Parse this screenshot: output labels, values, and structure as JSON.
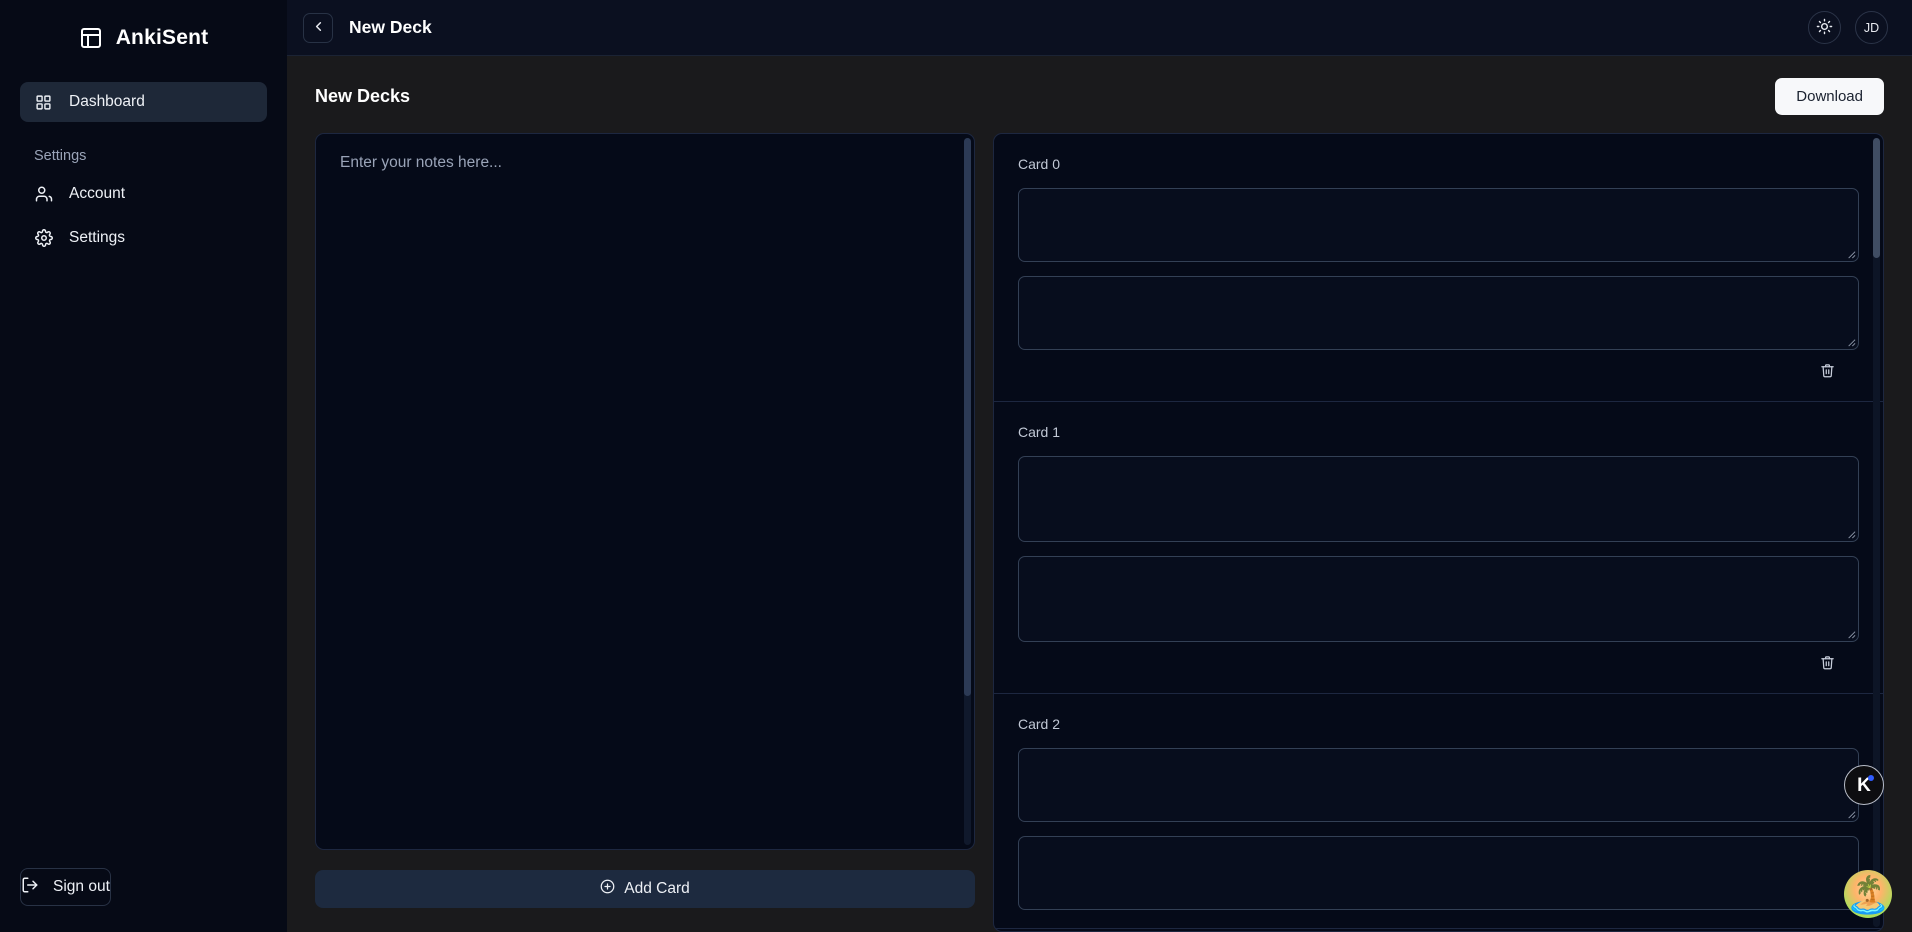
{
  "brand": {
    "name": "AnkiSent",
    "logo_icon": "layout-panel-icon"
  },
  "sidebar": {
    "primary": [
      {
        "label": "Dashboard",
        "icon": "grid-dashboard-icon",
        "active": true
      }
    ],
    "section_label": "Settings",
    "secondary": [
      {
        "label": "Account",
        "icon": "users-icon"
      },
      {
        "label": "Settings",
        "icon": "gear-icon"
      }
    ],
    "signout": {
      "label": "Sign out",
      "icon": "logout-icon"
    }
  },
  "topbar": {
    "back_icon": "chevron-left-icon",
    "title": "New Deck",
    "theme_icon": "sun-icon",
    "avatar_initials": "JD"
  },
  "main": {
    "page_title": "New Decks",
    "download_label": "Download",
    "notes": {
      "placeholder": "Enter your notes here..."
    },
    "add_card": {
      "label": "Add Card",
      "icon": "plus-circle-icon"
    },
    "cards": [
      {
        "label": "Card 0",
        "front": "",
        "back": "",
        "front_height": 74,
        "back_height": 74,
        "delete_icon": "trash-icon"
      },
      {
        "label": "Card 1",
        "front": "",
        "back": "",
        "front_height": 86,
        "back_height": 86,
        "delete_icon": "trash-icon"
      },
      {
        "label": "Card 2",
        "front": "",
        "back": "",
        "front_height": 74,
        "back_height": 74,
        "delete_icon": "trash-icon"
      }
    ]
  },
  "widgets": {
    "assistant": {
      "letter": "K",
      "badge_color": "#2f5cff"
    },
    "island": {
      "icon": "island-emoji"
    }
  },
  "colors": {
    "sidebar_bg": "#060a16",
    "topbar_bg": "#0b1020",
    "content_bg": "#1a1a1c",
    "panel_bg": "#050a18",
    "panel_border": "#1d2740",
    "accent_active": "#1e2838",
    "download_bg": "#f7f8fa",
    "add_card_bg": "#1d2a3f",
    "muted_text": "#9aa4b8"
  }
}
